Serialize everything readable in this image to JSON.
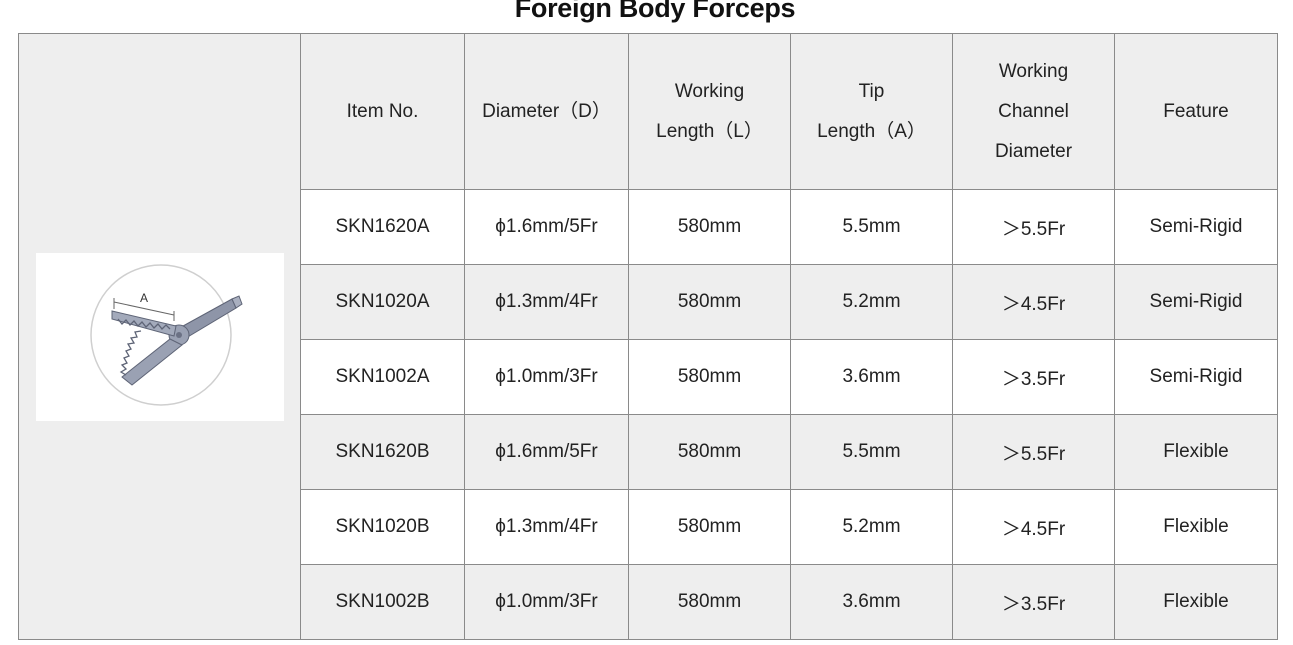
{
  "title": "Foreign Body Forceps",
  "headers": {
    "item_no": "Item No.",
    "diameter": "Diameter（D）",
    "working_length_l1": "Working",
    "working_length_l2": "Length（L）",
    "tip_length_l1": "Tip",
    "tip_length_l2": "Length（A）",
    "channel_l1": "Working",
    "channel_l2": "Channel",
    "channel_l3": "Diameter",
    "feature": "Feature"
  },
  "illustration": {
    "dimension_label": "A",
    "icon": "forceps-tip-illustration"
  },
  "rows": [
    {
      "item_no": "SKN1620A",
      "diameter": "ϕ1.6mm/5Fr",
      "working_length": "580mm",
      "tip_length": "5.5mm",
      "channel": "＞5.5Fr",
      "feature": "Semi-Rigid"
    },
    {
      "item_no": "SKN1020A",
      "diameter": "ϕ1.3mm/4Fr",
      "working_length": "580mm",
      "tip_length": "5.2mm",
      "channel": "＞4.5Fr",
      "feature": "Semi-Rigid"
    },
    {
      "item_no": "SKN1002A",
      "diameter": "ϕ1.0mm/3Fr",
      "working_length": "580mm",
      "tip_length": "3.6mm",
      "channel": "＞3.5Fr",
      "feature": "Semi-Rigid"
    },
    {
      "item_no": "SKN1620B",
      "diameter": "ϕ1.6mm/5Fr",
      "working_length": "580mm",
      "tip_length": "5.5mm",
      "channel": "＞5.5Fr",
      "feature": "Flexible"
    },
    {
      "item_no": "SKN1020B",
      "diameter": "ϕ1.3mm/4Fr",
      "working_length": "580mm",
      "tip_length": "5.2mm",
      "channel": "＞4.5Fr",
      "feature": "Flexible"
    },
    {
      "item_no": "SKN1002B",
      "diameter": "ϕ1.0mm/3Fr",
      "working_length": "580mm",
      "tip_length": "3.6mm",
      "channel": "＞3.5Fr",
      "feature": "Flexible"
    }
  ]
}
